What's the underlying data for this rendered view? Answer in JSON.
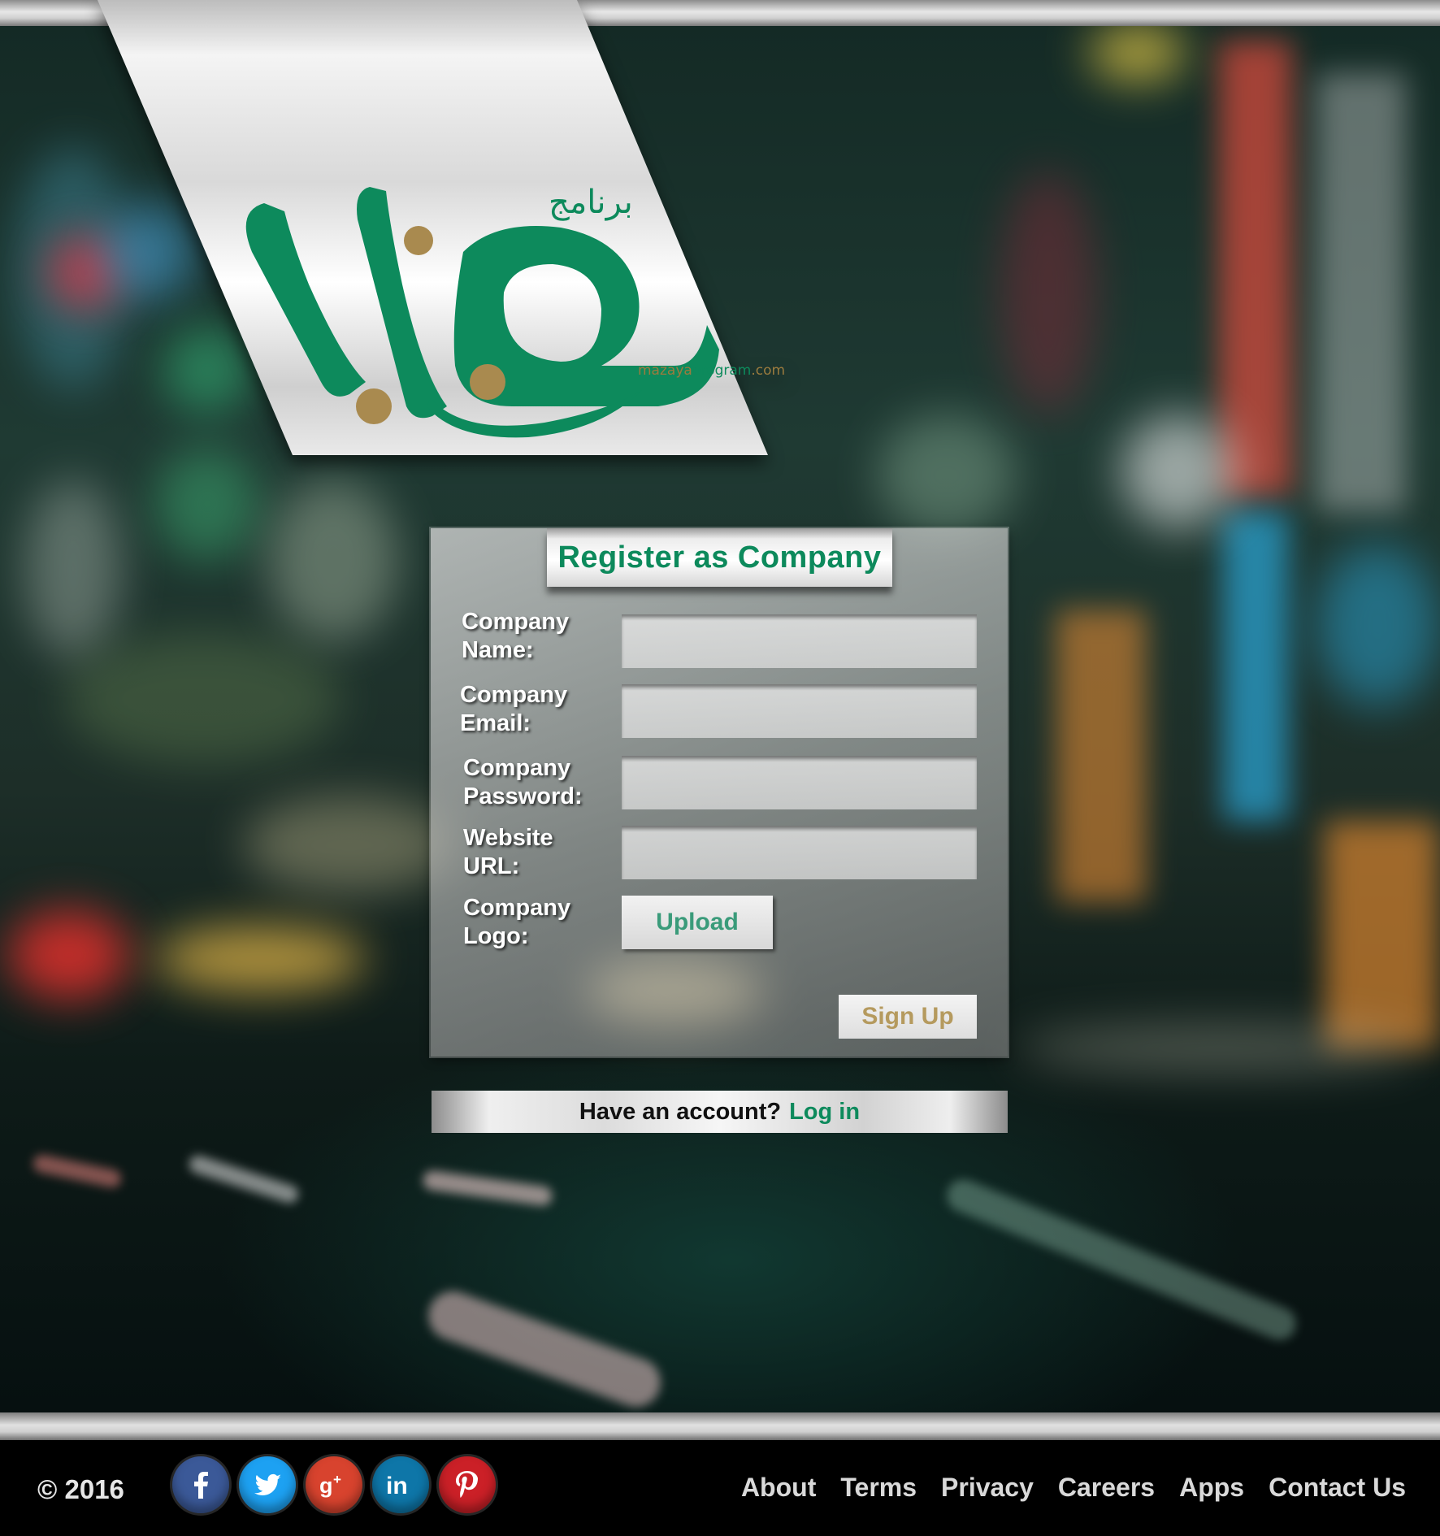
{
  "brand": {
    "logo_arabic_small": "برنامج",
    "logo_arabic_main": "مزايا",
    "logo_url_prefix": "mazaya",
    "logo_url_middle": "program",
    "logo_url_suffix": ".com",
    "color_green": "#0d8a5c",
    "color_gold": "#a98a4f"
  },
  "register": {
    "title": "Register as Company",
    "fields": [
      {
        "label_line1": "Company",
        "label_line2": "Name:",
        "value": "",
        "placeholder": ""
      },
      {
        "label_line1": "Company",
        "label_line2": "Email:",
        "value": "",
        "placeholder": ""
      },
      {
        "label_line1": "Company",
        "label_line2": "Password:",
        "value": "",
        "placeholder": ""
      },
      {
        "label_line1": "Website",
        "label_line2": "URL:",
        "value": "",
        "placeholder": ""
      }
    ],
    "logo_label_line1": "Company",
    "logo_label_line2": "Logo:",
    "upload_label": "Upload",
    "signup_label": "Sign Up"
  },
  "login": {
    "prompt": "Have an account?",
    "link": "Log in"
  },
  "footer": {
    "copyright": "© 2016",
    "social": [
      {
        "name": "facebook-icon",
        "color": "#3b5998"
      },
      {
        "name": "twitter-icon",
        "color": "#1da1f2"
      },
      {
        "name": "google-plus-icon",
        "color": "#d8432e"
      },
      {
        "name": "linkedin-icon",
        "color": "#0e76a8"
      },
      {
        "name": "pinterest-icon",
        "color": "#cb2027"
      }
    ],
    "links": [
      "About",
      "Terms",
      "Privacy",
      "Careers",
      "Apps",
      "Contact Us"
    ]
  }
}
